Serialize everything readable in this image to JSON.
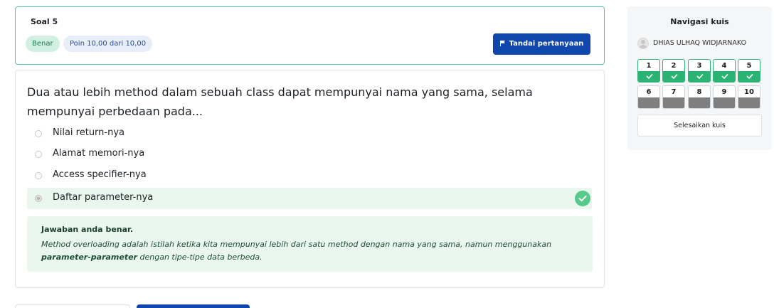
{
  "question": {
    "title": "Soal 5",
    "status_badge": "Benar",
    "points_badge": "Poin 10,00 dari 10,00",
    "flag_label": "Tandai pertanyaan",
    "text": "Dua atau lebih method dalam sebuah class dapat mempunyai nama yang sama, selama mempunyai perbedaan pada...",
    "options": [
      {
        "label": "Nilai return-nya",
        "selected": false
      },
      {
        "label": "Alamat memori-nya",
        "selected": false
      },
      {
        "label": "Access specifier-nya",
        "selected": false
      },
      {
        "label": "Daftar parameter-nya",
        "selected": true,
        "correct": true
      }
    ],
    "feedback": {
      "title": "Jawaban anda benar.",
      "text_before": "Method overloading adalah istilah ketika kita mempunyai lebih dari satu method dengan nama yang sama, namun menggunakan ",
      "text_bold": "parameter-parameter",
      "text_after": " dengan tipe-tipe data berbeda."
    }
  },
  "navigation": {
    "title": "Navigasi kuis",
    "user_name": "DHIAS ULHAQ WIDJARNAKO",
    "questions": [
      {
        "label": "1",
        "answered": true
      },
      {
        "label": "2",
        "answered": true
      },
      {
        "label": "3",
        "answered": true
      },
      {
        "label": "4",
        "answered": true
      },
      {
        "label": "5",
        "answered": true
      },
      {
        "label": "6",
        "answered": false
      },
      {
        "label": "7",
        "answered": false
      },
      {
        "label": "8",
        "answered": false
      },
      {
        "label": "9",
        "answered": false
      },
      {
        "label": "10",
        "answered": false
      }
    ],
    "finish_label": "Selesaikan kuis"
  },
  "colors": {
    "primary": "#0f47ad",
    "success": "#2bb373",
    "success_bg": "#e9f7ee",
    "unanswered": "#7f7f7f"
  }
}
